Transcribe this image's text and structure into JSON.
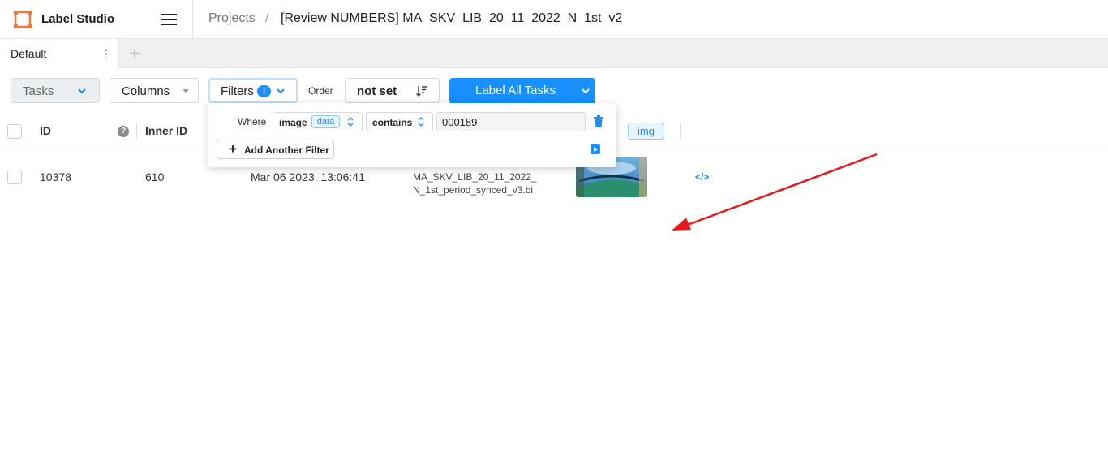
{
  "header": {
    "brand": "Label Studio",
    "breadcrumb": {
      "projects": "Projects",
      "separator": "/",
      "title": "[Review NUMBERS] MA_SKV_LIB_20_11_2022_N_1st_v2"
    }
  },
  "tabs": {
    "items": [
      {
        "label": "Default"
      }
    ],
    "menu_glyph": "⋮",
    "add_glyph": "+"
  },
  "toolbar": {
    "tasks_label": "Tasks",
    "columns_label": "Columns",
    "filters_label": "Filters",
    "filters_count": "1",
    "order_label": "Order",
    "order_value": "not set",
    "label_all_label": "Label All Tasks"
  },
  "filter_popup": {
    "where_label": "Where",
    "field": "image",
    "field_tag": "data",
    "operator": "contains",
    "value": "000189",
    "add_filter_label": "Add Another Filter"
  },
  "table": {
    "columns": {
      "id": "ID",
      "inner_id": "Inner ID",
      "image_tag": "img"
    },
    "help_glyph": "?",
    "rows": [
      {
        "id": "10378",
        "inner_id": "610",
        "created": "Mar 06 2023, 13:06:41",
        "path_line1": "MA_SKV_LIB_20_11_2022_",
        "path_line2": "N_1st_period_synced_v3.bi",
        "code_glyph": "</>"
      }
    ]
  },
  "colors": {
    "accent": "#1890ff",
    "annotation_arrow": "#e8191a"
  }
}
